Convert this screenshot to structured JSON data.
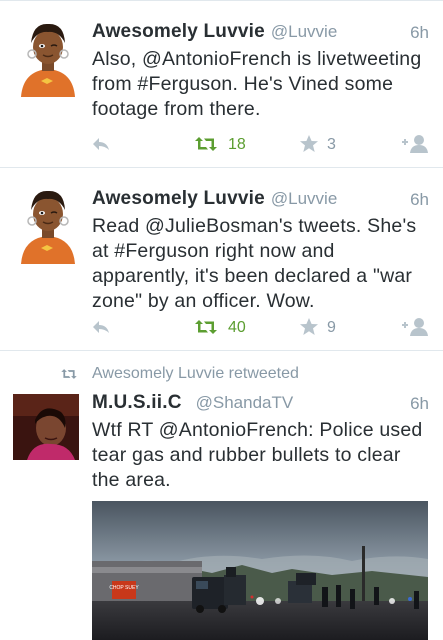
{
  "tweets": [
    {
      "name": "Awesomely Luvvie",
      "handle": "@Luvvie",
      "time": "6h",
      "text": "Also, @AntonioFrench is livetweeting from #Ferguson. He's Vined some footage from there.",
      "retweet_count": "18",
      "favorite_count": "3"
    },
    {
      "name": "Awesomely Luvvie",
      "handle": "@Luvvie",
      "time": "6h",
      "text": "Read @JulieBosman's tweets. She's at #Ferguson right now and apparently, it's been declared a \"war zone\" by an officer. Wow.",
      "retweet_count": "40",
      "favorite_count": "9"
    },
    {
      "retweeted_by": "Awesomely Luvvie retweeted",
      "name": "M.U.S.ii.C",
      "handle": "@ShandaTV",
      "time": "6h",
      "text": "Wtf RT @AntonioFrench: Police used tear gas and rubber bullets to clear the area.",
      "media_sign": "CHOP SUEY"
    }
  ],
  "colors": {
    "retweet_active": "#5c9e31",
    "muted": "#8899a6",
    "divider": "#e1e8ed"
  },
  "icons": [
    "reply-icon",
    "retweet-icon",
    "favorite-star-icon",
    "follow-icon"
  ]
}
